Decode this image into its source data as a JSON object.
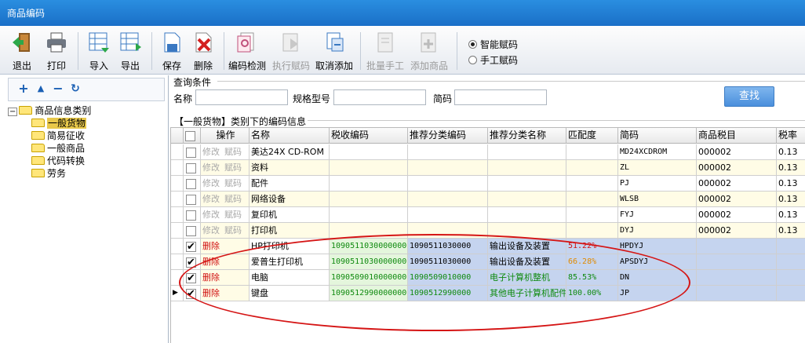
{
  "window": {
    "title": "商品编码"
  },
  "toolbar": {
    "buttons": [
      {
        "label": "退出",
        "icon": "exit-icon"
      },
      {
        "label": "打印",
        "icon": "printer-icon"
      },
      {
        "label": "导入",
        "icon": "import-icon"
      },
      {
        "label": "导出",
        "icon": "export-icon"
      },
      {
        "label": "保存",
        "icon": "save-icon"
      },
      {
        "label": "删除",
        "icon": "delete-icon"
      },
      {
        "label": "编码检测",
        "icon": "code-check-icon"
      },
      {
        "label": "执行赋码",
        "icon": "run-code-icon"
      },
      {
        "label": "取消添加",
        "icon": "cancel-add-icon"
      },
      {
        "label": "批量手工",
        "icon": "batch-manual-icon"
      },
      {
        "label": "添加商品",
        "icon": "add-product-icon"
      }
    ],
    "radio": [
      {
        "label": "智能赋码",
        "checked": true
      },
      {
        "label": "手工赋码",
        "checked": false
      }
    ]
  },
  "tree": {
    "root": "商品信息类别",
    "children": [
      "一般货物",
      "简易征收",
      "一般商品",
      "代码转换",
      "劳务"
    ],
    "selected": "一般货物",
    "tools": [
      "plus-icon",
      "up-icon",
      "minus-icon",
      "refresh-icon"
    ]
  },
  "query": {
    "title": "查询条件",
    "name_label": "名称",
    "spec_label": "规格型号",
    "abbr_label": "简码",
    "search_button": "查找"
  },
  "grid": {
    "title": "【一般货物】类别下的编码信息",
    "headers": [
      "操作",
      "名称",
      "税收编码",
      "推荐分类编码",
      "推荐分类名称",
      "匹配度",
      "简码",
      "商品税目",
      "税率"
    ],
    "rows": [
      {
        "checked": false,
        "act1": "修改",
        "act2": "赋码",
        "name": "美达24X CD-ROM",
        "taxcode": "",
        "reccode": "",
        "recname": "",
        "match": "",
        "abbr": "MD24XCDROM",
        "item": "000002",
        "rate": "0.13",
        "style": "plain"
      },
      {
        "checked": false,
        "act1": "修改",
        "act2": "赋码",
        "name": "资料",
        "taxcode": "",
        "reccode": "",
        "recname": "",
        "match": "",
        "abbr": "ZL",
        "item": "000002",
        "rate": "0.13",
        "style": "plain"
      },
      {
        "checked": false,
        "act1": "修改",
        "act2": "赋码",
        "name": "配件",
        "taxcode": "",
        "reccode": "",
        "recname": "",
        "match": "",
        "abbr": "PJ",
        "item": "000002",
        "rate": "0.13",
        "style": "plain"
      },
      {
        "checked": false,
        "act1": "修改",
        "act2": "赋码",
        "name": "网络设备",
        "taxcode": "",
        "reccode": "",
        "recname": "",
        "match": "",
        "abbr": "WLSB",
        "item": "000002",
        "rate": "0.13",
        "style": "plain"
      },
      {
        "checked": false,
        "act1": "修改",
        "act2": "赋码",
        "name": "复印机",
        "taxcode": "",
        "reccode": "",
        "recname": "",
        "match": "",
        "abbr": "FYJ",
        "item": "000002",
        "rate": "0.13",
        "style": "plain"
      },
      {
        "checked": false,
        "act1": "修改",
        "act2": "赋码",
        "name": "打印机",
        "taxcode": "",
        "reccode": "",
        "recname": "",
        "match": "",
        "abbr": "DYJ",
        "item": "000002",
        "rate": "0.13",
        "style": "plain"
      },
      {
        "checked": true,
        "act1": "删除",
        "act2": "",
        "name": "HP打印机",
        "taxcode": "10905110300000000",
        "reccode": "1090511030000",
        "recname": "输出设备及装置",
        "match": "51.22%",
        "abbr": "HPDYJ",
        "item": "",
        "rate": "",
        "style": "new",
        "matchColor": "red",
        "recColor": "black"
      },
      {
        "checked": true,
        "act1": "删除",
        "act2": "",
        "name": "爱普生打印机",
        "taxcode": "10905110300000000",
        "reccode": "1090511030000",
        "recname": "输出设备及装置",
        "match": "66.28%",
        "abbr": "APSDYJ",
        "item": "",
        "rate": "",
        "style": "new",
        "matchColor": "orange",
        "recColor": "black"
      },
      {
        "checked": true,
        "act1": "删除",
        "act2": "",
        "name": "电脑",
        "taxcode": "10905090100000000",
        "reccode": "1090509010000",
        "recname": "电子计算机整机",
        "match": "85.53%",
        "abbr": "DN",
        "item": "",
        "rate": "",
        "style": "new",
        "matchColor": "green",
        "recColor": "green"
      },
      {
        "checked": true,
        "act1": "删除",
        "act2": "",
        "name": "键盘",
        "taxcode": "10905129900000000",
        "reccode": "1090512990000",
        "recname": "其他电子计算机配件",
        "match": "100.00%",
        "abbr": "JP",
        "item": "",
        "rate": "",
        "style": "new",
        "matchColor": "green",
        "recColor": "green",
        "current": true
      }
    ]
  },
  "colors": {
    "title_bar": "#1f7ad2",
    "annotation": "#d51515",
    "new_row": "#c5d4ef"
  }
}
